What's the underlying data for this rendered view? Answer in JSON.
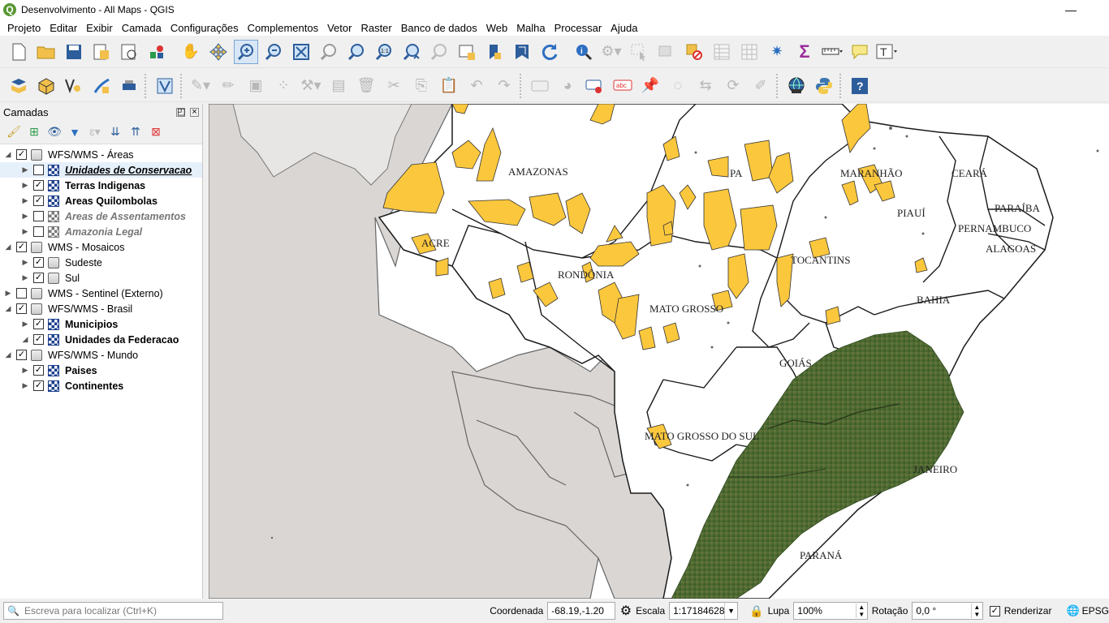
{
  "window": {
    "title": "Desenvolvimento - All Maps - QGIS",
    "minimize_glyph": "—"
  },
  "menu": [
    "Projeto",
    "Editar",
    "Exibir",
    "Camada",
    "Configurações",
    "Complementos",
    "Vetor",
    "Raster",
    "Banco de dados",
    "Web",
    "Malha",
    "Processar",
    "Ajuda"
  ],
  "panel": {
    "title": "Camadas",
    "layers": [
      {
        "name": "WFS/WMS - Áreas",
        "checked": true,
        "expanded": true,
        "kind": "group",
        "style": "normal"
      },
      {
        "name": "Unidades de Conservacao",
        "checked": false,
        "expanded": false,
        "kind": "wms",
        "style": "bu"
      },
      {
        "name": "Terras Indigenas",
        "checked": true,
        "expanded": false,
        "kind": "wms",
        "style": "bold"
      },
      {
        "name": "Areas Quilombolas",
        "checked": true,
        "expanded": false,
        "kind": "wms",
        "style": "bold"
      },
      {
        "name": "Areas de Assentamentos",
        "checked": false,
        "expanded": false,
        "kind": "wmsg",
        "style": "it"
      },
      {
        "name": "Amazonia Legal",
        "checked": false,
        "expanded": false,
        "kind": "wmsg",
        "style": "it"
      },
      {
        "name": "WMS - Mosaicos",
        "checked": true,
        "expanded": true,
        "kind": "group",
        "style": "normal"
      },
      {
        "name": "Sudeste",
        "checked": true,
        "expanded": false,
        "kind": "group",
        "style": "normal"
      },
      {
        "name": "Sul",
        "checked": true,
        "expanded": false,
        "kind": "group",
        "style": "normal"
      },
      {
        "name": "WMS - Sentinel (Externo)",
        "checked": false,
        "expanded": false,
        "kind": "group",
        "style": "normal"
      },
      {
        "name": "WFS/WMS - Brasil",
        "checked": true,
        "expanded": true,
        "kind": "group",
        "style": "normal"
      },
      {
        "name": "Municipios",
        "checked": true,
        "expanded": false,
        "kind": "wms",
        "style": "bold"
      },
      {
        "name": "Unidades da Federacao",
        "checked": true,
        "expanded": true,
        "kind": "wms",
        "style": "bold"
      },
      {
        "name": "WFS/WMS - Mundo",
        "checked": true,
        "expanded": true,
        "kind": "group",
        "style": "normal"
      },
      {
        "name": "Paises",
        "checked": true,
        "expanded": false,
        "kind": "wms",
        "style": "bold"
      },
      {
        "name": "Continentes",
        "checked": true,
        "expanded": false,
        "kind": "wms",
        "style": "bold"
      }
    ]
  },
  "map": {
    "state_labels": [
      "AMAZONAS",
      "PA",
      "MARANHÃO",
      "CEARÁ",
      "PIAUÍ",
      "PARAÍBA",
      "PERNAMBUCO",
      "ALAGOAS",
      "ACRE",
      "RONDÔNIA",
      "MATO GROSSO",
      "TOCANTINS",
      "BAHIA",
      "GOIÁS",
      "MATO GROSSO DO SUL",
      "JANEIRO",
      "PARANÁ"
    ],
    "colors": {
      "land": "#ffffff",
      "neighbors": "#d9d6d4",
      "areas": "#fbc73d",
      "border": "#1a1a1a",
      "satellite": "#4d6b30"
    }
  },
  "statusbar": {
    "locator_placeholder": "Escreva para localizar (Ctrl+K)",
    "coordinate_label": "Coordenada",
    "coordinate_value": "-68.19,-1.20",
    "scale_label": "Escala",
    "scale_value": "1:17184628",
    "magnifier_label": "Lupa",
    "magnifier_value": "100%",
    "rotation_label": "Rotação",
    "rotation_value": "0,0 °",
    "render_label": "Renderizar",
    "crs_label": "EPSG"
  }
}
